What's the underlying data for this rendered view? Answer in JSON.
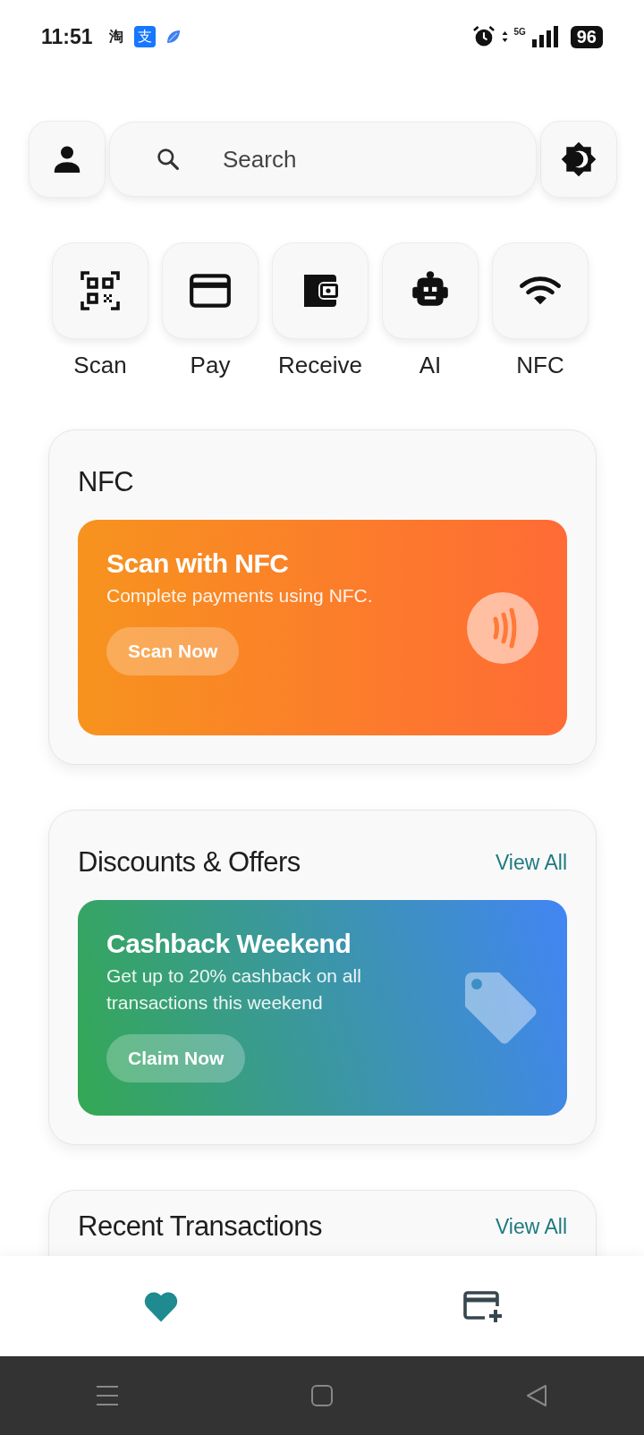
{
  "status_bar": {
    "time": "11:51",
    "notification_icons": [
      {
        "kind": "glyph",
        "glyph": "淘"
      },
      {
        "kind": "badge",
        "glyph": "支"
      },
      {
        "kind": "leaf"
      }
    ],
    "network": "5G",
    "battery": "96"
  },
  "search": {
    "placeholder": "Search"
  },
  "quick_actions": [
    {
      "kind": "scan",
      "label": "Scan"
    },
    {
      "kind": "pay",
      "label": "Pay"
    },
    {
      "kind": "receive",
      "label": "Receive"
    },
    {
      "kind": "ai",
      "label": "AI"
    },
    {
      "kind": "nfc",
      "label": "NFC"
    }
  ],
  "sections": [
    {
      "title": "NFC",
      "banner": {
        "kind": "nfc",
        "title": "Scan with NFC",
        "text": "Complete payments using NFC.",
        "button": "Scan Now"
      }
    },
    {
      "title": "Discounts & Offers",
      "link": "View All",
      "banner": {
        "kind": "offer",
        "title": "Cashback Weekend",
        "text": "Get up to 20% cashback on all transactions this weekend",
        "button": "Claim Now"
      }
    },
    {
      "title": "Recent Transactions",
      "link": "View All"
    }
  ],
  "bottom_nav": [
    {
      "kind": "favorites",
      "selected": true
    },
    {
      "kind": "add_card",
      "selected": false
    }
  ]
}
